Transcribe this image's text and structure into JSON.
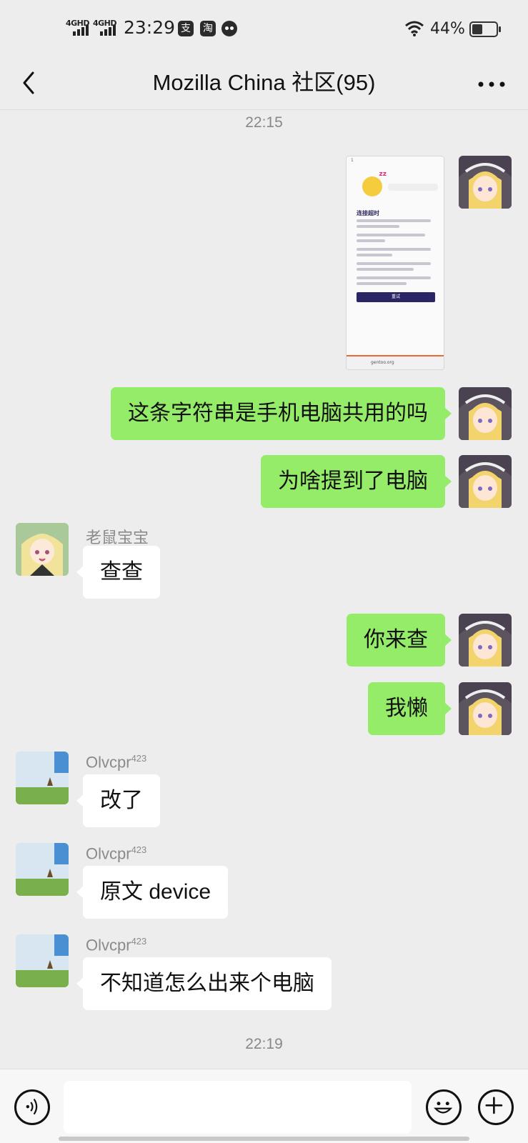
{
  "status_bar": {
    "net1": "4GHD",
    "net2": "4GHD",
    "time": "23:29",
    "app_icon_1": "支",
    "app_icon_2": "淘",
    "battery": "44%"
  },
  "header": {
    "title": "Mozilla China 社区(95)",
    "back_icon": "chevron-left-icon",
    "more_icon": "more-dots-icon"
  },
  "messages": {
    "time_1": "22:15",
    "shared_screenshot": {
      "status": "1",
      "heading": "连接超时",
      "button": "重试",
      "url": "gentoo.org"
    },
    "m1": "这条字符串是手机电脑共用的吗",
    "m2": "为啥提到了电脑",
    "m3_sender": "老鼠宝宝",
    "m3": "查查",
    "m4": "你来查",
    "m5": "我懒",
    "m6_sender": "Olvcpr",
    "m6_sup": "423",
    "m6": "改了",
    "m7_sender": "Olvcpr",
    "m7_sup": "423",
    "m7": "原文 device",
    "m8_sender": "Olvcpr",
    "m8_sup": "423",
    "m8": "不知道怎么出来个电脑",
    "time_2": "22:19"
  },
  "input_bar": {
    "voice_icon": "voice-icon",
    "emoji_icon": "emoji-icon",
    "plus_icon": "plus-icon",
    "text": ""
  }
}
